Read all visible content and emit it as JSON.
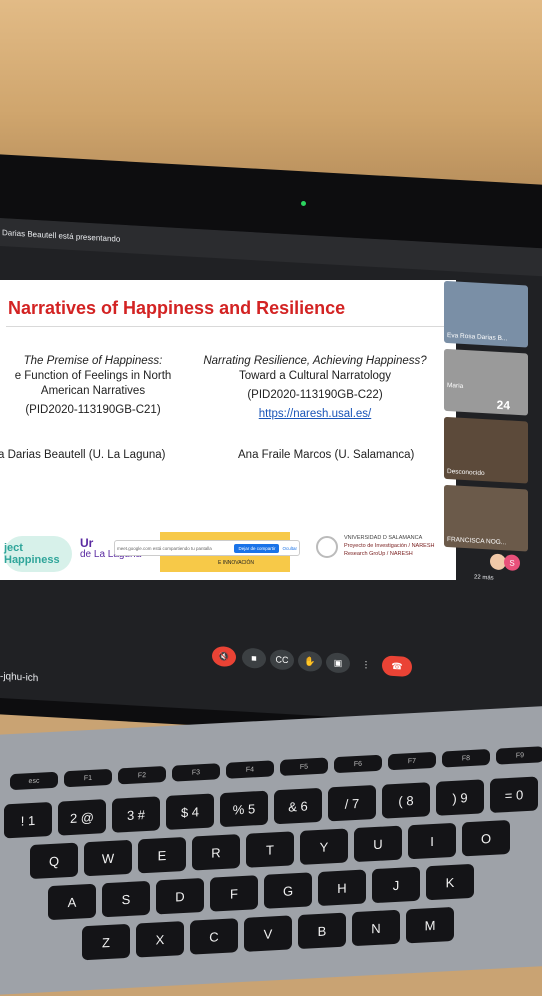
{
  "presenter_banner": "Darias Beautell está presentando",
  "slide": {
    "title": "Narratives of Happiness and Resilience",
    "left": {
      "line1": "The Premise of Happiness:",
      "line2": "e Function of Feelings in North",
      "line3": "American Narratives",
      "line4": "(PID2020-113190GB-C21)",
      "author": "a Darias Beautell (U. La Laguna)"
    },
    "right": {
      "line1": "Narrating Resilience, Achieving Happiness?",
      "line2": "Toward a Cultural Narratology",
      "line3": "(PID2020-113190GB-C22)",
      "link": "https://naresh.usal.es/",
      "author": "Ana Fraile Marcos (U. Salamanca)"
    },
    "logos": {
      "project": "ject Happiness",
      "ull_line1": "Ur",
      "ull_line2": "de La Laguna",
      "innovation": "E INNOVACIÓN",
      "usal_line1": "VNIVERSIDAD D SALAMANCA",
      "usal_line2": "Proyecto de Investigación / NARESH",
      "usal_line3": "Research GroUp / NARESH"
    },
    "share_banner": {
      "text": "meet.google.com está compartiendo tu pantalla",
      "button": "Dejar de compartir",
      "hide": "Ocultar"
    }
  },
  "participants": [
    {
      "name": "Eva Rosa Darias B...",
      "bg": "#7a8fa6"
    },
    {
      "name": "Maria",
      "badge": "24",
      "bg": "#9a9a9a"
    },
    {
      "name": "Desconocido",
      "bg": "#5c4a3a"
    },
    {
      "name": "FRANCISCA NOG...",
      "bg": "#6b5a4a"
    }
  ],
  "more_participants": "22 más",
  "avatars": [
    {
      "letter": "S",
      "color": "#e8507a"
    }
  ],
  "controls": [
    "mic-off",
    "camera",
    "captions",
    "raise-hand",
    "present",
    "more",
    "leave-call"
  ],
  "meeting_code": "-jqhu-ich",
  "keyboard": {
    "fn_row": [
      "esc",
      "F1",
      "F2",
      "F3",
      "F4",
      "F5",
      "F6",
      "F7",
      "F8",
      "F9",
      "F10"
    ],
    "num_row": [
      "! 1",
      "2 @",
      "3 #",
      "$ 4",
      "% 5",
      "& 6",
      "/ 7",
      "( 8",
      ") 9",
      "= 0"
    ],
    "q_row": [
      "Q",
      "W",
      "E",
      "R",
      "T",
      "Y",
      "U",
      "I",
      "O"
    ],
    "a_row": [
      "A",
      "S",
      "D",
      "F",
      "G",
      "H",
      "J",
      "K"
    ],
    "z_row": [
      "Z",
      "X",
      "C",
      "V",
      "B",
      "N",
      "M"
    ]
  },
  "colors": {
    "accent_red": "#d32323",
    "leave_red": "#ea4335",
    "link_blue": "#1a55b8"
  }
}
